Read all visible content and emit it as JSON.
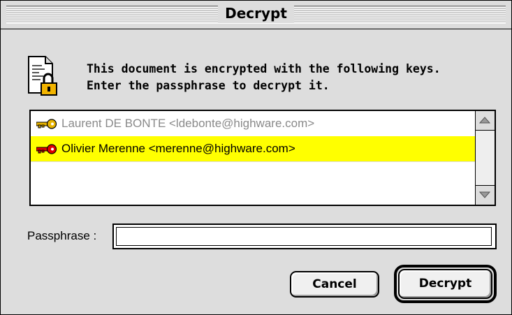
{
  "window": {
    "title": "Decrypt"
  },
  "message": {
    "line1": "This document is encrypted with the following keys.",
    "line2": "Enter the passphrase to decrypt it."
  },
  "keys": [
    {
      "label": "Laurent DE BONTE <ldebonte@highware.com>",
      "key_color": "#e8b400",
      "state": "disabled"
    },
    {
      "label": "Olivier Merenne <merenne@highware.com>",
      "key_color": "#e00000",
      "state": "selected"
    }
  ],
  "passphrase": {
    "label": "Passphrase :",
    "value": "",
    "placeholder": ""
  },
  "buttons": {
    "cancel": "Cancel",
    "decrypt": "Decrypt"
  },
  "colors": {
    "selection": "#ffff00",
    "dim_text": "#8a8a8a",
    "background": "#dddddd"
  },
  "icons": {
    "document": "encrypted-document-icon",
    "key": "key-icon"
  }
}
